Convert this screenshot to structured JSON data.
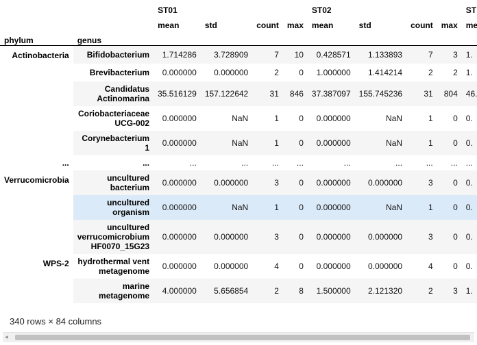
{
  "table": {
    "top_headers": [
      "ST01",
      "ST02",
      "ST"
    ],
    "stat_headers": [
      "mean",
      "std",
      "count",
      "max",
      "mean",
      "std",
      "count",
      "max",
      "me"
    ],
    "index_names": [
      "phylum",
      "genus"
    ],
    "rows": [
      {
        "phylum": "Actinobacteria",
        "genus": "Bifidobacterium",
        "cells": [
          "1.714286",
          "3.728909",
          "7",
          "10",
          "0.428571",
          "1.133893",
          "7",
          "3",
          "1."
        ]
      },
      {
        "phylum": "",
        "genus": "Brevibacterium",
        "cells": [
          "0.000000",
          "0.000000",
          "2",
          "0",
          "1.000000",
          "1.414214",
          "2",
          "2",
          "1."
        ]
      },
      {
        "phylum": "",
        "genus": "Candidatus Actinomarina",
        "cells": [
          "35.516129",
          "157.122642",
          "31",
          "846",
          "37.387097",
          "155.745236",
          "31",
          "804",
          "46."
        ]
      },
      {
        "phylum": "",
        "genus": "Coriobacteriaceae UCG-002",
        "cells": [
          "0.000000",
          "NaN",
          "1",
          "0",
          "0.000000",
          "NaN",
          "1",
          "0",
          "0."
        ]
      },
      {
        "phylum": "",
        "genus": "Corynebacterium 1",
        "cells": [
          "0.000000",
          "NaN",
          "1",
          "0",
          "0.000000",
          "NaN",
          "1",
          "0",
          "0."
        ]
      },
      {
        "phylum": "...",
        "genus": "...",
        "cells": [
          "...",
          "...",
          "...",
          "...",
          "...",
          "...",
          "...",
          "...",
          "..."
        ],
        "ellipsis": true
      },
      {
        "phylum": "Verrucomicrobia",
        "genus": "uncultured bacterium",
        "cells": [
          "0.000000",
          "0.000000",
          "3",
          "0",
          "0.000000",
          "0.000000",
          "3",
          "0",
          "0."
        ]
      },
      {
        "phylum": "",
        "genus": "uncultured organism",
        "cells": [
          "0.000000",
          "NaN",
          "1",
          "0",
          "0.000000",
          "NaN",
          "1",
          "0",
          "0."
        ],
        "highlight": true
      },
      {
        "phylum": "",
        "genus": "uncultured verrucomicrobium HF0070_15G23",
        "cells": [
          "0.000000",
          "0.000000",
          "3",
          "0",
          "0.000000",
          "0.000000",
          "3",
          "0",
          "0."
        ]
      },
      {
        "phylum": "WPS-2",
        "genus": "hydrothermal vent metagenome",
        "cells": [
          "0.000000",
          "0.000000",
          "4",
          "0",
          "0.000000",
          "0.000000",
          "4",
          "0",
          "0."
        ]
      },
      {
        "phylum": "",
        "genus": "marine metagenome",
        "cells": [
          "4.000000",
          "5.656854",
          "2",
          "8",
          "1.500000",
          "2.121320",
          "2",
          "3",
          "1."
        ]
      }
    ]
  },
  "footer": {
    "shape_text": "340 rows × 84 columns"
  },
  "scrollbar": {
    "left_arrow": "◂"
  }
}
